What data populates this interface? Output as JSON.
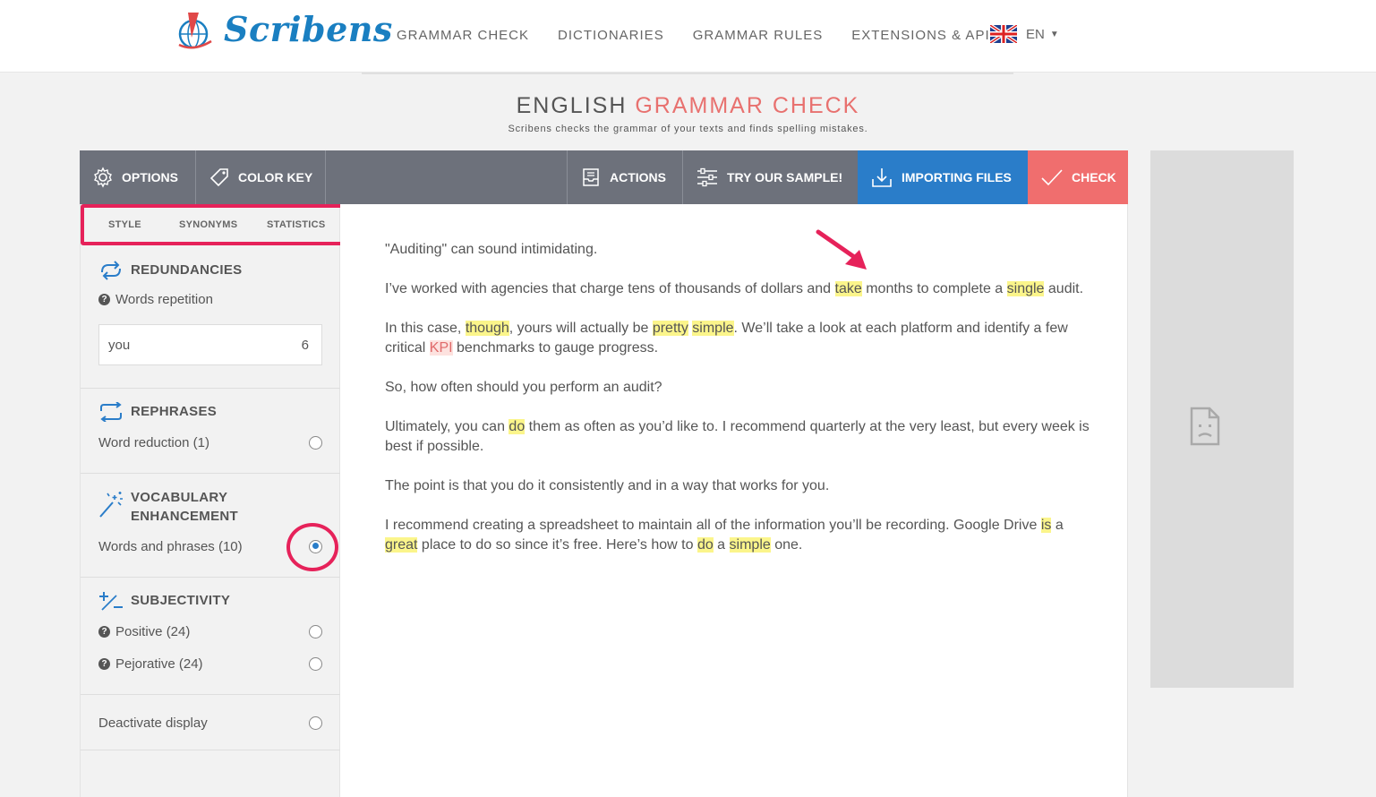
{
  "brand": {
    "name": "Scribens"
  },
  "nav": {
    "items": [
      "GRAMMAR CHECK",
      "DICTIONARIES",
      "GRAMMAR RULES",
      "EXTENSIONS & API"
    ],
    "language": "EN"
  },
  "page": {
    "title_part1": "ENGLISH",
    "title_part2": "GRAMMAR CHECK",
    "subtitle": "Scribens checks the grammar of your texts and finds spelling mistakes."
  },
  "toolbar": {
    "options": "OPTIONS",
    "color_key": "COLOR KEY",
    "actions": "ACTIONS",
    "sample": "TRY OUR SAMPLE!",
    "importing": "IMPORTING FILES",
    "check": "CHECK"
  },
  "subtabs": [
    "STYLE",
    "SYNONYMS",
    "STATISTICS"
  ],
  "sidebar": {
    "redundancies": {
      "title": "REDUNDANCIES",
      "label": "Words repetition",
      "word": "you",
      "count": "6"
    },
    "rephrases": {
      "title": "REPHRASES",
      "item": "Word reduction (1)"
    },
    "vocabulary": {
      "title_line1": "VOCABULARY",
      "title_line2": "ENHANCEMENT",
      "item": "Words and phrases (10)",
      "selected": true
    },
    "subjectivity": {
      "title": "SUBJECTIVITY",
      "positive": "Positive (24)",
      "pejorative": "Pejorative (24)"
    },
    "deactivate": "Deactivate display"
  },
  "colors": {
    "toolbar": "#6d717b",
    "import": "#2a7dc9",
    "check": "#f06e6e",
    "highlight": "#fbf58b",
    "annotation": "#e6225a"
  },
  "text": {
    "p1": "\"Auditing\" can sound intimidating.",
    "p2": [
      "I’ve worked with agencies that charge tens of thousands of dollars and ",
      "take",
      " months to complete a ",
      "single",
      " audit."
    ],
    "p3": [
      "In this case, ",
      "though",
      ", yours will actually be ",
      "pretty",
      " ",
      "simple",
      ". We’ll take a look at each platform and identify a few critical ",
      "KPI",
      " benchmarks to gauge progress."
    ],
    "p4": "So, how often should you perform an audit?",
    "p5": [
      "Ultimately, you can ",
      "do",
      " them as often as you’d like to. I recommend quarterly at the very least, but every week is best if possible."
    ],
    "p6": "The point is that you do it consistently and in a way that works for you.",
    "p7": [
      "I recommend creating a spreadsheet to maintain all of the information you’ll be recording. Google Drive ",
      "is",
      " a ",
      "great",
      " place to do so since it’s free. Here’s how to ",
      "do",
      " a ",
      "simple",
      " one."
    ]
  }
}
